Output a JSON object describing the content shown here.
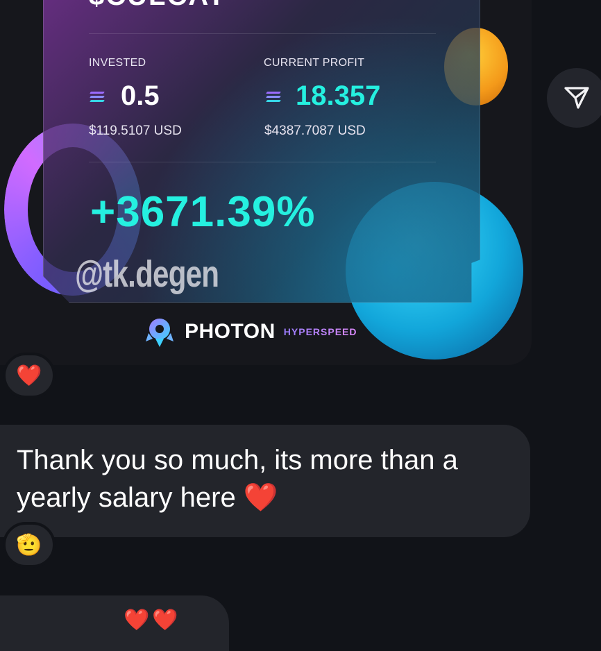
{
  "card": {
    "title_partial": "$CULCAT",
    "invested_label": "INVESTED",
    "invested_sol": "0.5",
    "invested_usd": "$119.5107 USD",
    "profit_label": "CURRENT PROFIT",
    "profit_sol": "18.357",
    "profit_usd": "$4387.7087 USD",
    "percent": "+3671.39%",
    "watermark": "@tk.degen"
  },
  "brand": {
    "name": "PHOTON",
    "tagline": "HYPERSPEED"
  },
  "reactions": {
    "first": "❤️",
    "second": "🫡"
  },
  "message": {
    "text": "Thank you so much, its more than a yearly salary here ❤️"
  },
  "message_next": {
    "emoji": "❤️❤️"
  },
  "colors": {
    "profit": "#25f0e0",
    "background": "#111318",
    "bubble": "#23252b"
  },
  "icons": {
    "share": "share-icon",
    "solana": "solana-icon",
    "photon": "photon-logo"
  }
}
